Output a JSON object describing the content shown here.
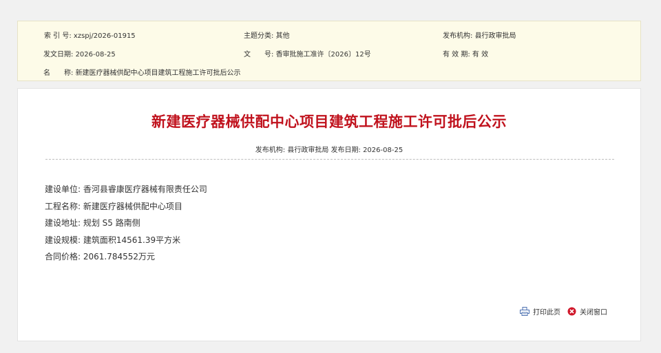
{
  "meta": {
    "index_label": "索 引 号:",
    "index_value": "xzspj/2026-01915",
    "topic_label": "主题分类:",
    "topic_value": "其他",
    "publisher_label": "发布机构:",
    "publisher_value": "县行政审批局",
    "date_label": "发文日期:",
    "date_value": "2026-08-25",
    "doc_no_label": "文　　号:",
    "doc_no_value": "香审批施工准许〔2026〕12号",
    "validity_label": "有 效 期:",
    "validity_value": "有 效",
    "name_label": "名　　称:",
    "name_value": "新建医疗器械供配中心项目建筑工程施工许可批后公示"
  },
  "article": {
    "title": "新建医疗器械供配中心项目建筑工程施工许可批后公示",
    "subline": "发布机构: 县行政审批局 发布日期: 2026-08-25",
    "lines": [
      "建设单位: 香河县睿康医疗器械有限责任公司",
      "工程名称: 新建医疗器械供配中心项目",
      "建设地址: 规划 S5 路南侧",
      "建设规模: 建筑面积14561.39平方米",
      "合同价格: 2061.784552万元"
    ]
  },
  "tools": {
    "print_label": "打印此页",
    "close_label": "关闭窗口"
  },
  "colors": {
    "title": "#c0121d",
    "meta_background": "#fdfbe8",
    "print_icon": "#4a6fb0",
    "close_icon": "#d0172a"
  },
  "icons": {
    "print": "printer-icon",
    "close": "close-circle-icon"
  }
}
